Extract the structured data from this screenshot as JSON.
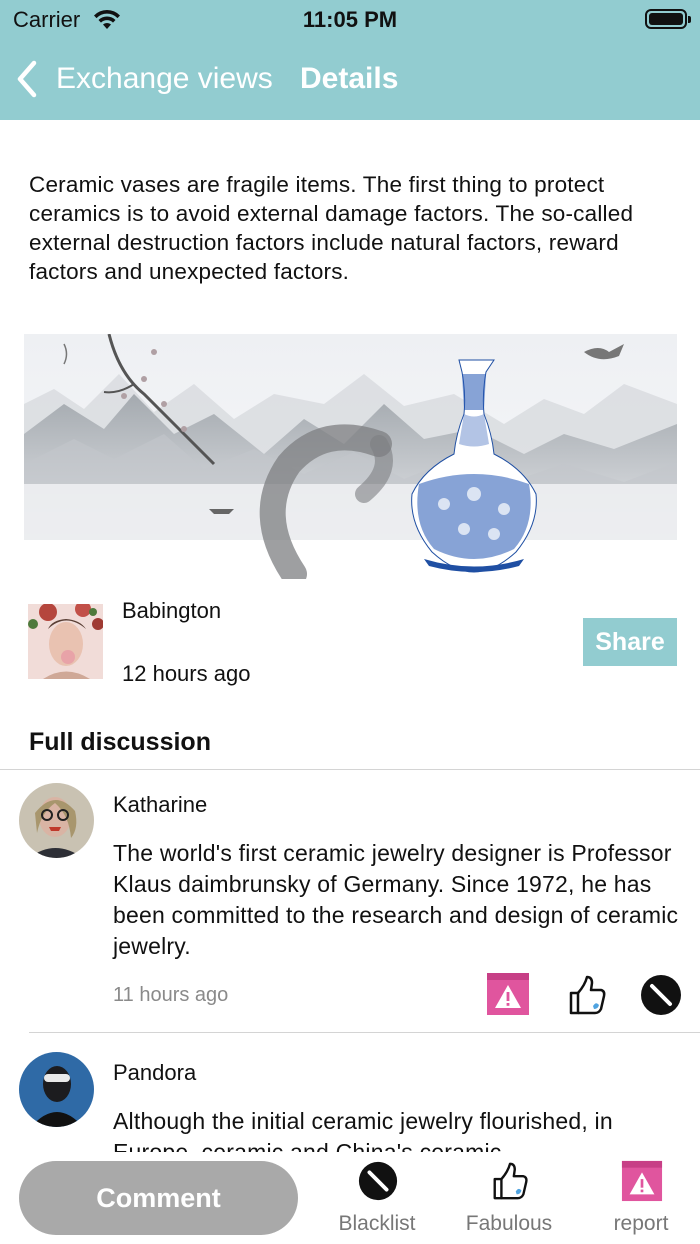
{
  "status_bar": {
    "carrier": "Carrier",
    "time": "11:05 PM"
  },
  "nav": {
    "back_label": "Exchange views",
    "title": "Details"
  },
  "article": {
    "text": "Ceramic vases are fragile items. The first thing to protect ceramics is to avoid external damage factors. The so-called external destruction factors include natural factors, reward factors and unexpected factors."
  },
  "author": {
    "name": "Babington",
    "time": "12 hours ago",
    "share_label": "Share"
  },
  "discussion": {
    "title": "Full discussion",
    "comments": [
      {
        "name": "Katharine",
        "text": "The world's first ceramic jewelry designer is Professor Klaus daimbrunsky of Germany. Since 1972, he has been committed to the research and design of ceramic jewelry.",
        "time": "11 hours ago",
        "actions": [
          "report-icon",
          "thumbs-up-icon",
          "blacklist-icon"
        ]
      },
      {
        "name": "Pandora",
        "text": "Although the initial ceramic jewelry flourished, in Europe, ceramic and China's ceramic"
      }
    ]
  },
  "bottom_bar": {
    "comment_label": "Comment",
    "tabs": [
      {
        "label": "Blacklist",
        "icon": "blacklist-icon"
      },
      {
        "label": "Fabulous",
        "icon": "thumbs-up-icon"
      },
      {
        "label": "report",
        "icon": "report-icon"
      }
    ]
  },
  "colors": {
    "header": "#92ccd0",
    "share_button": "#92ccd0",
    "comment_button": "#a9a9a9",
    "report_icon": "#e0559e",
    "divider": "#d4d4d4"
  }
}
